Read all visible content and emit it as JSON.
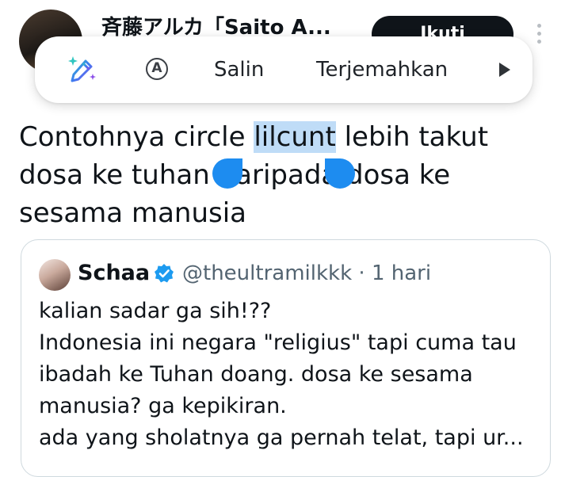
{
  "header": {
    "author_name": "斉藤アルカ「Saito A...",
    "follow_label": "Ikuti",
    "more_icon": "more-vertical-icon"
  },
  "selection_toolbar": {
    "ai_icon": "ai-sparkle-pen-icon",
    "autofill_icon": "circle-a-icon",
    "autofill_glyph": "A",
    "copy_label": "Salin",
    "translate_label": "Terjemahkan",
    "more_icon": "play-arrow-icon"
  },
  "tweet": {
    "text_before": "Contohnya circle ",
    "selected": "lilcunt",
    "text_after": " lebih takut dosa ke tuhan daripada dosa ke sesama manusia",
    "selection_color": "#bfdcf7",
    "handle_color": "#1d8cf0"
  },
  "quote": {
    "name": "Schaa",
    "verified_icon": "verified-badge-icon",
    "verified_color": "#1d9bf0",
    "handle": "@theultramilkkk",
    "separator": " · ",
    "time": "1 hari",
    "lines": [
      "kalian sadar ga sih!??",
      "Indonesia ini negara \"religius\" tapi cuma tau",
      "ibadah ke Tuhan doang. dosa ke sesama",
      "manusia? ga kepikiran.",
      "ada yang sholatnya ga pernah telat, tapi ur..."
    ]
  }
}
